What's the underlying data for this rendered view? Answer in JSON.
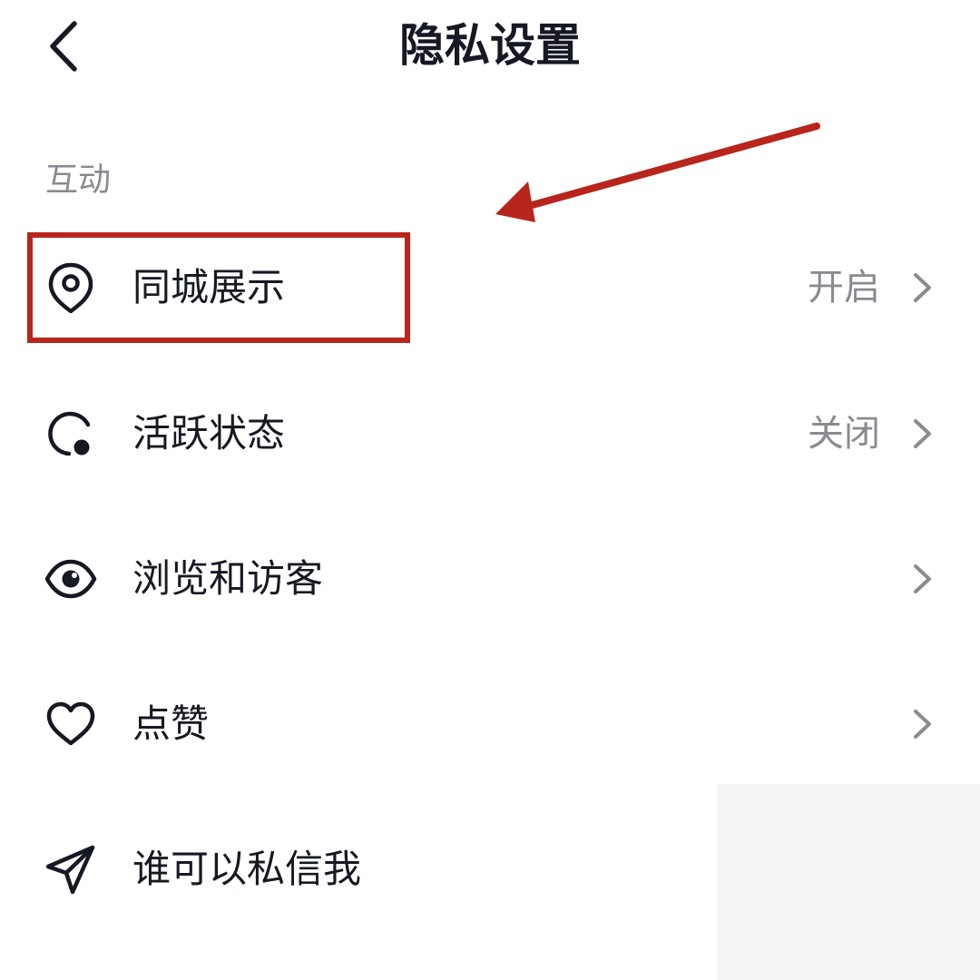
{
  "header": {
    "title": "隐私设置",
    "back_icon": "chevron-left-icon"
  },
  "section": {
    "label": "互动"
  },
  "rows": [
    {
      "label": "同城展示",
      "value": "开启",
      "icon": "location-pin-icon"
    },
    {
      "label": "活跃状态",
      "value": "关闭",
      "icon": "activity-status-icon"
    },
    {
      "label": "浏览和访客",
      "value": "",
      "icon": "eye-icon"
    },
    {
      "label": "点赞",
      "value": "",
      "icon": "heart-icon"
    },
    {
      "label": "谁可以私信我",
      "value": "",
      "icon": "send-icon"
    }
  ],
  "annotation": {
    "highlight_color": "#b8251c"
  }
}
